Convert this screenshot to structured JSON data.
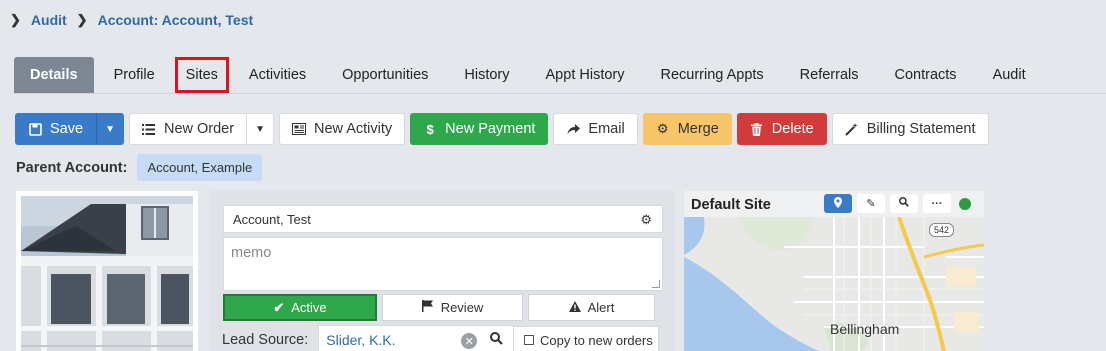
{
  "breadcrumb": {
    "root": "Audit",
    "current": "Account: Account, Test"
  },
  "tabs": [
    {
      "label": "Details"
    },
    {
      "label": "Profile"
    },
    {
      "label": "Sites"
    },
    {
      "label": "Activities"
    },
    {
      "label": "Opportunities"
    },
    {
      "label": "History"
    },
    {
      "label": "Appt History"
    },
    {
      "label": "Recurring Appts"
    },
    {
      "label": "Referrals"
    },
    {
      "label": "Contracts"
    },
    {
      "label": "Audit"
    }
  ],
  "active_tab": "Details",
  "highlighted_tab": "Sites",
  "toolbar": {
    "save": "Save",
    "new_order": "New Order",
    "new_activity": "New Activity",
    "new_payment": "New Payment",
    "email": "Email",
    "merge": "Merge",
    "delete": "Delete",
    "billing_statement": "Billing Statement"
  },
  "parent_account": {
    "label": "Parent Account:",
    "value": "Account, Example"
  },
  "account": {
    "name": "Account, Test",
    "memo_placeholder": "memo",
    "status": {
      "active": "Active",
      "review": "Review",
      "alert": "Alert"
    },
    "lead_source_label": "Lead Source:",
    "lead_source_value": "Slider, K.K.",
    "copy_to_new_orders": "Copy to new orders"
  },
  "map": {
    "title": "Default Site",
    "city_label": "Bellingham",
    "route_shield": "542"
  },
  "colors": {
    "accent_blue": "#3a7bc8",
    "success_green": "#2ea84a",
    "warning_yellow": "#f7c56a",
    "danger_red": "#d33b3b",
    "highlight_red": "#e0111b"
  }
}
